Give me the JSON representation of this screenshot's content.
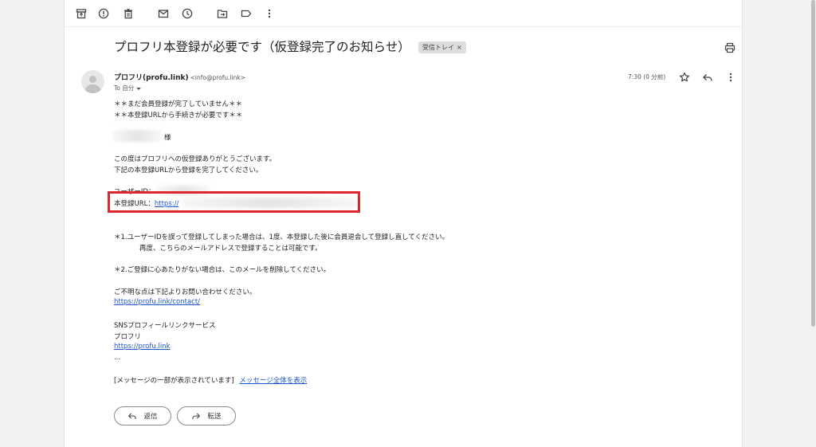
{
  "subject": {
    "title": "プロフリ本登録が必要です（仮登録完了のお知らせ）",
    "label": "受信トレイ",
    "label_close": "×"
  },
  "toolbar": {
    "icons": [
      "archive-icon",
      "report-spam-icon",
      "delete-icon",
      "mark-unread-icon",
      "snooze-icon",
      "move-to-icon",
      "label-icon",
      "more-icon"
    ]
  },
  "sender": {
    "name": "プロフリ(profu.link)",
    "email": "<info@profu.link>",
    "to": "To 自分",
    "time": "7:30 (0 分前)"
  },
  "body": {
    "line1": "＊＊まだ会員登録が完了していません＊＊",
    "line2": "＊＊本登録URLから手続きが必要です＊＊",
    "honorific": "様",
    "thanks": "この度はプロフリへの仮登録ありがとうございます。",
    "instruction": "下記の本登録URLから登録を完了してください。",
    "user_id_label": "ユーザーID：",
    "url_label": "本登録URL：",
    "url_text": "https://",
    "note1a": "＊1.ユーザーIDを誤って登録してしまった場合は、1度、本登録した後に会員退会して登録し直してください。",
    "note1b": "再度、こちらのメールアドレスで登録することは可能です。",
    "note2": "＊2.ご登録に心あたりがない場合は、このメールを削除してください。",
    "inquiry": "ご不明な点は下記よりお問い合わせください。",
    "contact_link": "https://profu.link/contact/",
    "service": "SNSプロフィールリンクサービス",
    "brand": "プロフリ",
    "home_link": "https://profu.link",
    "ellipsis": "...",
    "clipped_notice": "[メッセージの一部が表示されています]",
    "view_full": "メッセージ全体を表示"
  },
  "actions": {
    "reply": "返信",
    "forward": "転送"
  },
  "colors": {
    "link": "#1a55c9",
    "highlight_box": "#e0262b"
  }
}
